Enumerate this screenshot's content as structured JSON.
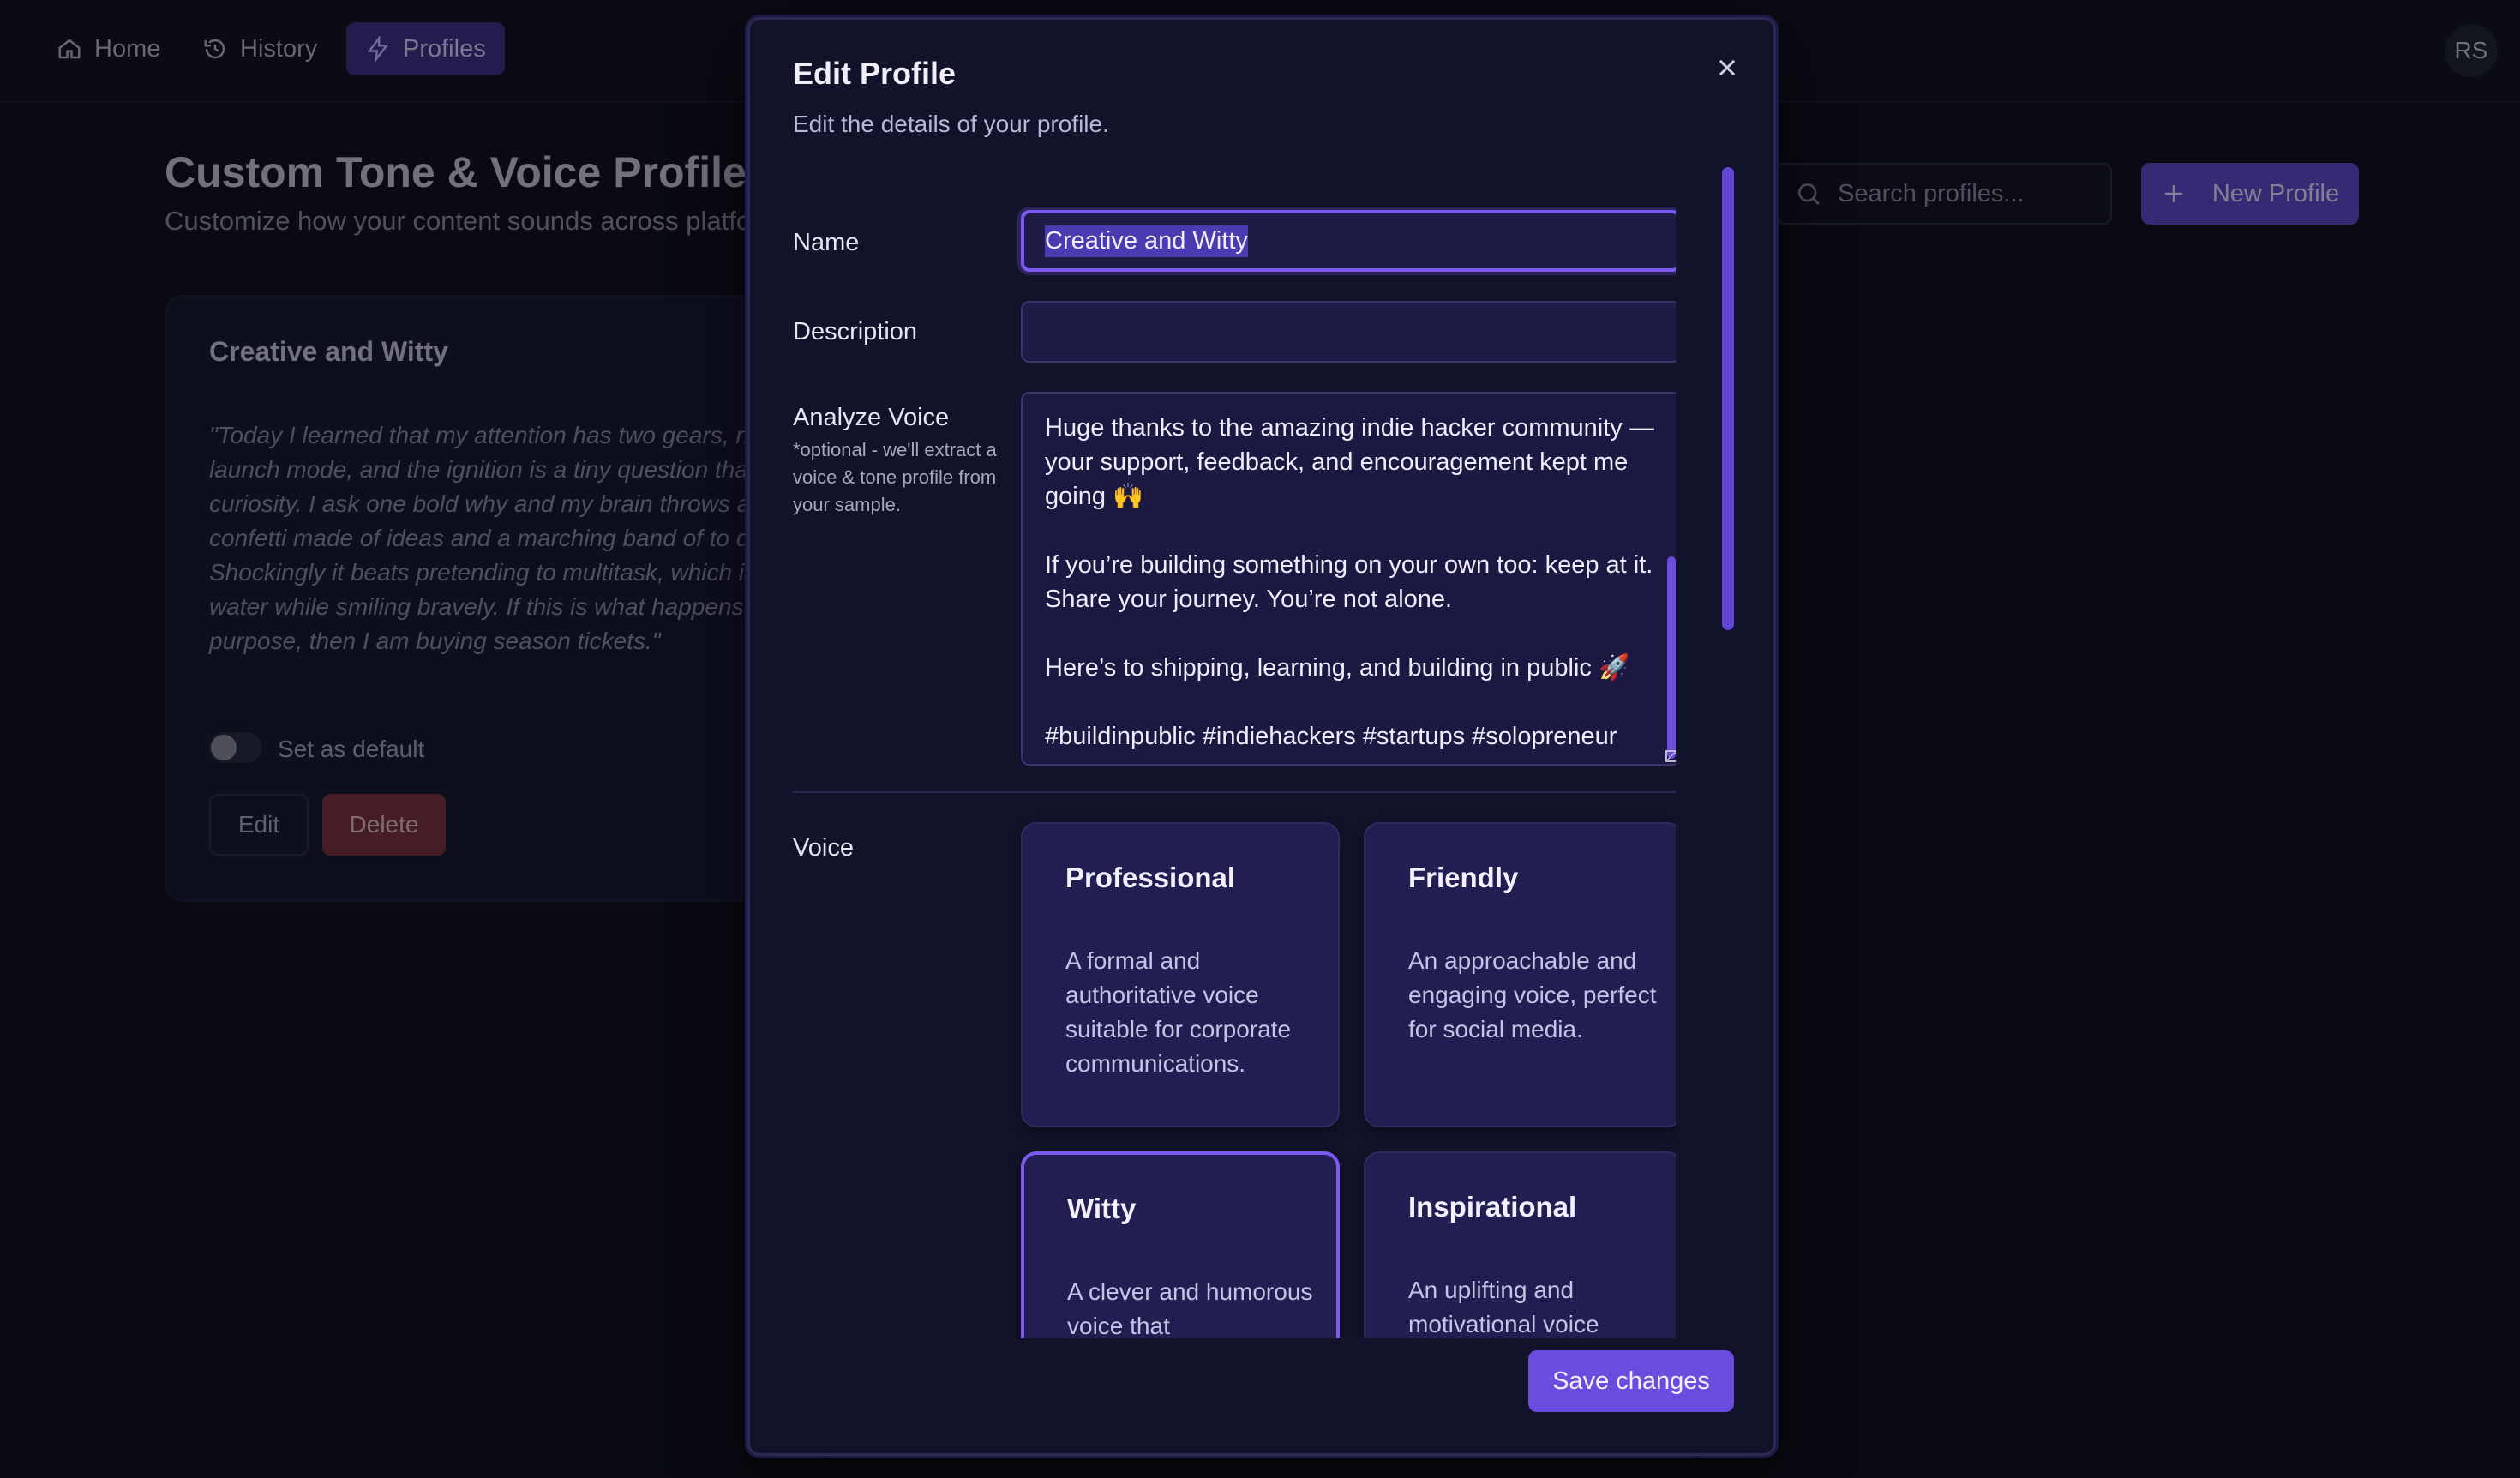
{
  "nav": {
    "items": [
      {
        "label": "Home",
        "icon": "home-icon"
      },
      {
        "label": "History",
        "icon": "history-icon"
      },
      {
        "label": "Profiles",
        "icon": "lightning-icon",
        "active": true
      }
    ],
    "avatar_initials": "RS"
  },
  "page": {
    "title": "Custom Tone & Voice Profiles",
    "subtitle": "Customize how your content sounds across platforms",
    "search_placeholder": "Search profiles...",
    "new_profile_label": "New Profile"
  },
  "profile_card": {
    "title": "Creative and Witty",
    "quote": "\"Today I learned that my attention has two gears, nap mode and launch mode, and the ignition is a tiny question that sparks curiosity. I ask one bold why and my brain throws a parade with confetti made of ideas and a marching band of to do lists. Shockingly it beats pretending to multitask, which is just juggling water while smiling bravely. If this is what happens when I focus on purpose, then I am buying season tickets.\"",
    "default_toggle_label": "Set as default",
    "default_toggle_on": false,
    "edit_label": "Edit",
    "delete_label": "Delete"
  },
  "modal": {
    "title": "Edit Profile",
    "description": "Edit the details of your profile.",
    "name_label": "Name",
    "name_value": "Creative and Witty",
    "description_label": "Description",
    "description_value": "",
    "analyze_label": "Analyze Voice",
    "analyze_hint": "*optional - we'll extract a voice & tone profile from your sample.",
    "analyze_lines": [
      "Huge thanks to the amazing indie hacker community —",
      "your support, feedback, and encouragement kept me",
      "going 🙌",
      "",
      "If you’re building something on your own too: keep at it.",
      "Share your journey. You’re not alone.",
      "",
      "Here’s to shipping, learning, and building in public 🚀",
      "",
      "#buildinpublic #indiehackers #startups #solopreneur"
    ],
    "voice_label": "Voice",
    "voices": [
      {
        "title": "Professional",
        "desc": "A formal and authoritative voice suitable for corporate communications.",
        "selected": false
      },
      {
        "title": "Friendly",
        "desc": "An approachable and engaging voice, perfect for social media.",
        "selected": false
      },
      {
        "title": "Witty",
        "desc": "A clever and humorous voice that",
        "selected": true
      },
      {
        "title": "Inspirational",
        "desc": "An uplifting and motivational voice",
        "selected": false
      }
    ],
    "save_label": "Save changes"
  },
  "colors": {
    "accent": "#6a4ddf",
    "background": "#0b0d16",
    "modal_bg": "#11132a",
    "card_bg": "#221e52"
  }
}
